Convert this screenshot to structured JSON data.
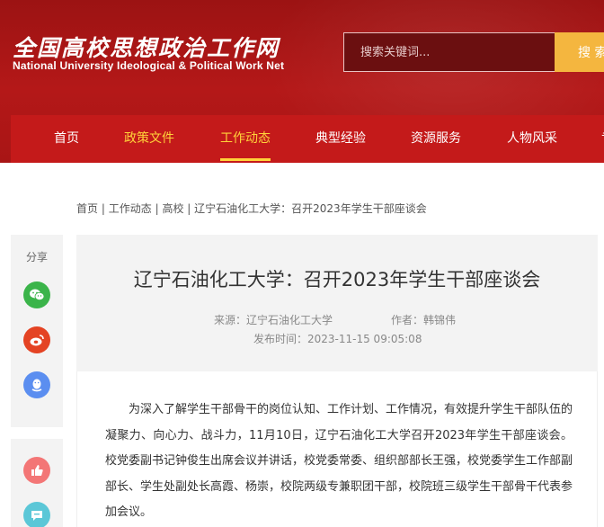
{
  "header": {
    "logo_cn": "全国高校思想政治工作网",
    "logo_en": "National University Ideological & Political Work Net",
    "search_placeholder": "搜索关键词...",
    "search_button": "搜 索"
  },
  "nav": {
    "items": [
      "首页",
      "政策文件",
      "工作动态",
      "典型经验",
      "资源服务",
      "人物风采",
      "专"
    ],
    "active_index": 2
  },
  "breadcrumb": {
    "items": [
      "首页",
      "工作动态",
      "高校",
      "辽宁石油化工大学：召开2023年学生干部座谈会"
    ],
    "separator": "|"
  },
  "share": {
    "label": "分享",
    "icons": [
      "wechat-icon",
      "weibo-icon",
      "qq-icon"
    ],
    "colors": {
      "wechat": "#3bb44a",
      "weibo": "#e44323",
      "qq": "#5b8ef0",
      "like": "#f37676",
      "comment": "#5bc7d7"
    }
  },
  "article": {
    "title": "辽宁石油化工大学：召开2023年学生干部座谈会",
    "source": "来源：辽宁石油化工大学",
    "author": "作者：韩锦伟",
    "publish_time": "发布时间：2023-11-15 09:05:08",
    "body": "为深入了解学生干部骨干的岗位认知、工作计划、工作情况，有效提升学生干部队伍的凝聚力、向心力、战斗力，11月10日，辽宁石油化工大学召开2023年学生干部座谈会。校党委副书记钟俊生出席会议并讲话，校党委常委、组织部部长王强，校党委学生工作部副部长、学生处副处长高霞、杨崇，校院两级专兼职团干部，校院班三级学生干部骨干代表参加会议。"
  },
  "colors": {
    "header_red": "#b41818",
    "nav_red": "#c41a1a",
    "accent_yellow": "#ffd23a",
    "search_button": "#f4b63f"
  }
}
